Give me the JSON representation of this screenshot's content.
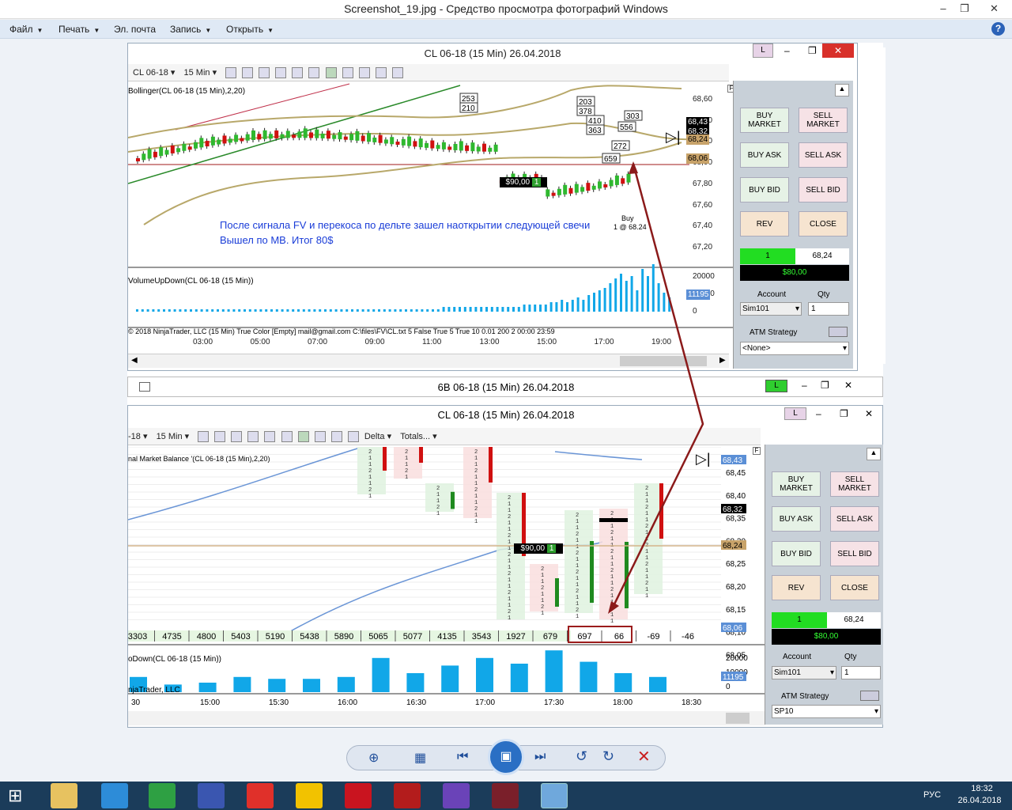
{
  "window": {
    "title": "Screenshot_19.jpg - Средство просмотра фотографий Windows"
  },
  "menu": {
    "file": "Файл",
    "print": "Печать",
    "email": "Эл. почта",
    "burn": "Запись",
    "open": "Открыть"
  },
  "chart1": {
    "title": "CL 06-18 (15 Min)  26.04.2018",
    "instrument": "CL 06-18",
    "interval": "15 Min",
    "indicator_label": "Bollinger(CL 06-18 (15 Min),2,20)",
    "volume_label": "VolumeUpDown(CL 06-18 (15 Min))",
    "footer_text": "© 2018 NinjaTrader, LLC (15 Min) True Color [Empty] mail@gmail.com C:\\files\\FV\\CL.txt 5 False True 5 True 10 0.01 200 2 00:00 23:59",
    "pnl_label": "$90,00",
    "pnl_qty": "1",
    "order_label_1": "Buy",
    "order_label_2": "1 @ 68.24",
    "note_line1": "После сигнала FV  и перекоса по дельте зашел наоткрытии следующей свечи",
    "note_line2": "Вышел по МВ. Итог 80$",
    "price_tags": [
      "68,43",
      "68,32",
      "68,24",
      "68,06"
    ],
    "y_axis": [
      "68,60",
      "68,40",
      "68,20",
      "68,00",
      "67,80",
      "67,60",
      "67,40",
      "67,20"
    ],
    "vol_axis": [
      "20000",
      "10000",
      "0"
    ],
    "vol_tag": "11195",
    "x_axis": [
      "03:00",
      "05:00",
      "07:00",
      "09:00",
      "11:00",
      "13:00",
      "15:00",
      "17:00",
      "19:00"
    ],
    "callouts": [
      "253",
      "210",
      "203",
      "378",
      "410",
      "363",
      "556",
      "303",
      "272",
      "659"
    ],
    "flag": "L"
  },
  "chart2": {
    "title": "6B 06-18 (15 Min)  26.04.2018",
    "flag": "L"
  },
  "chart3": {
    "title": "CL 06-18 (15 Min)  26.04.2018",
    "instrument": "18",
    "interval": "15 Min",
    "mode": "Delta",
    "totals": "Totals...",
    "indicator_label": "nal Market Balance  '(CL 06-18 (15 Min),2,20)",
    "volume_label": "oDown(CL 06-18 (15 Min))",
    "footer_text": "njaTrader, LLC",
    "pnl_label": "$90,00",
    "pnl_qty": "1",
    "price_tags": [
      "68,43",
      "68,32",
      "68,24",
      "68,06"
    ],
    "y_axis": [
      "68,45",
      "68,40",
      "68,35",
      "68,30",
      "68,25",
      "68,20",
      "68,15",
      "68,10",
      "68,05"
    ],
    "vol_axis": [
      "20000",
      "10000",
      "0"
    ],
    "vol_tag": "11195",
    "x_axis": [
      "30",
      "15:00",
      "15:30",
      "16:00",
      "16:30",
      "17:00",
      "17:30",
      "18:00",
      "18:30"
    ],
    "delta_totals": [
      "3303",
      "4735",
      "4800",
      "5403",
      "5190",
      "5438",
      "5890",
      "5065",
      "5077",
      "4135",
      "3543",
      "1927",
      "679",
      "697",
      "66",
      "-69",
      "-46"
    ],
    "flag": "L"
  },
  "panel1": {
    "buy_market": "BUY MARKET",
    "sell_market": "SELL MARKET",
    "buy_ask": "BUY ASK",
    "sell_ask": "SELL ASK",
    "buy_bid": "BUY BID",
    "sell_bid": "SELL BID",
    "rev": "REV",
    "close": "CLOSE",
    "position_qty": "1",
    "position_price": "68,24",
    "pnl": "$80,00",
    "account_label": "Account",
    "qty_label": "Qty",
    "account": "Sim101",
    "qty": "1",
    "atm_label": "ATM Strategy",
    "atm": "<None>"
  },
  "panel2": {
    "buy_market": "BUY MARKET",
    "sell_market": "SELL MARKET",
    "buy_ask": "BUY ASK",
    "sell_ask": "SELL ASK",
    "buy_bid": "BUY BID",
    "sell_bid": "SELL BID",
    "rev": "REV",
    "close": "CLOSE",
    "position_qty": "1",
    "position_price": "68,24",
    "pnl": "$80,00",
    "account_label": "Account",
    "qty_label": "Qty",
    "account": "Sim101",
    "qty": "1",
    "atm_label": "ATM Strategy",
    "atm": "SP10"
  },
  "taskbar": {
    "lang": "РУС",
    "time": "18:32",
    "date": "26.04.2018"
  },
  "colors": {
    "up": "#2a9a2a",
    "down": "#d01010",
    "volume": "#11a7e8",
    "bollinger": "#b8a86a",
    "trend": "#2a8a2a",
    "arrow": "#8b1a1a"
  },
  "volume_bars1": [
    1,
    1,
    1,
    1,
    1,
    1,
    1,
    1,
    1,
    1,
    1,
    1,
    1,
    1,
    1,
    1,
    1,
    1,
    1,
    1,
    1,
    1,
    1,
    1,
    1,
    1,
    1,
    1,
    1,
    1,
    1,
    1,
    1,
    1,
    1,
    1,
    1,
    1,
    1,
    1,
    1,
    1,
    1,
    1,
    1,
    1,
    1,
    1,
    1,
    1,
    1,
    1,
    1,
    1,
    1,
    1,
    1,
    2,
    2,
    2,
    2,
    2,
    2,
    2,
    2,
    2,
    2,
    2,
    2,
    2,
    2,
    2,
    3,
    3,
    3,
    3,
    3,
    4,
    4,
    5,
    4,
    5,
    6,
    5,
    7,
    8,
    9,
    10,
    12,
    14,
    16,
    13,
    15,
    9,
    18,
    15,
    20,
    12,
    8,
    6
  ],
  "volume_bars3": [
    8,
    4,
    5,
    8,
    7,
    7,
    8,
    18,
    10,
    14,
    18,
    15,
    22,
    16,
    10,
    8
  ]
}
